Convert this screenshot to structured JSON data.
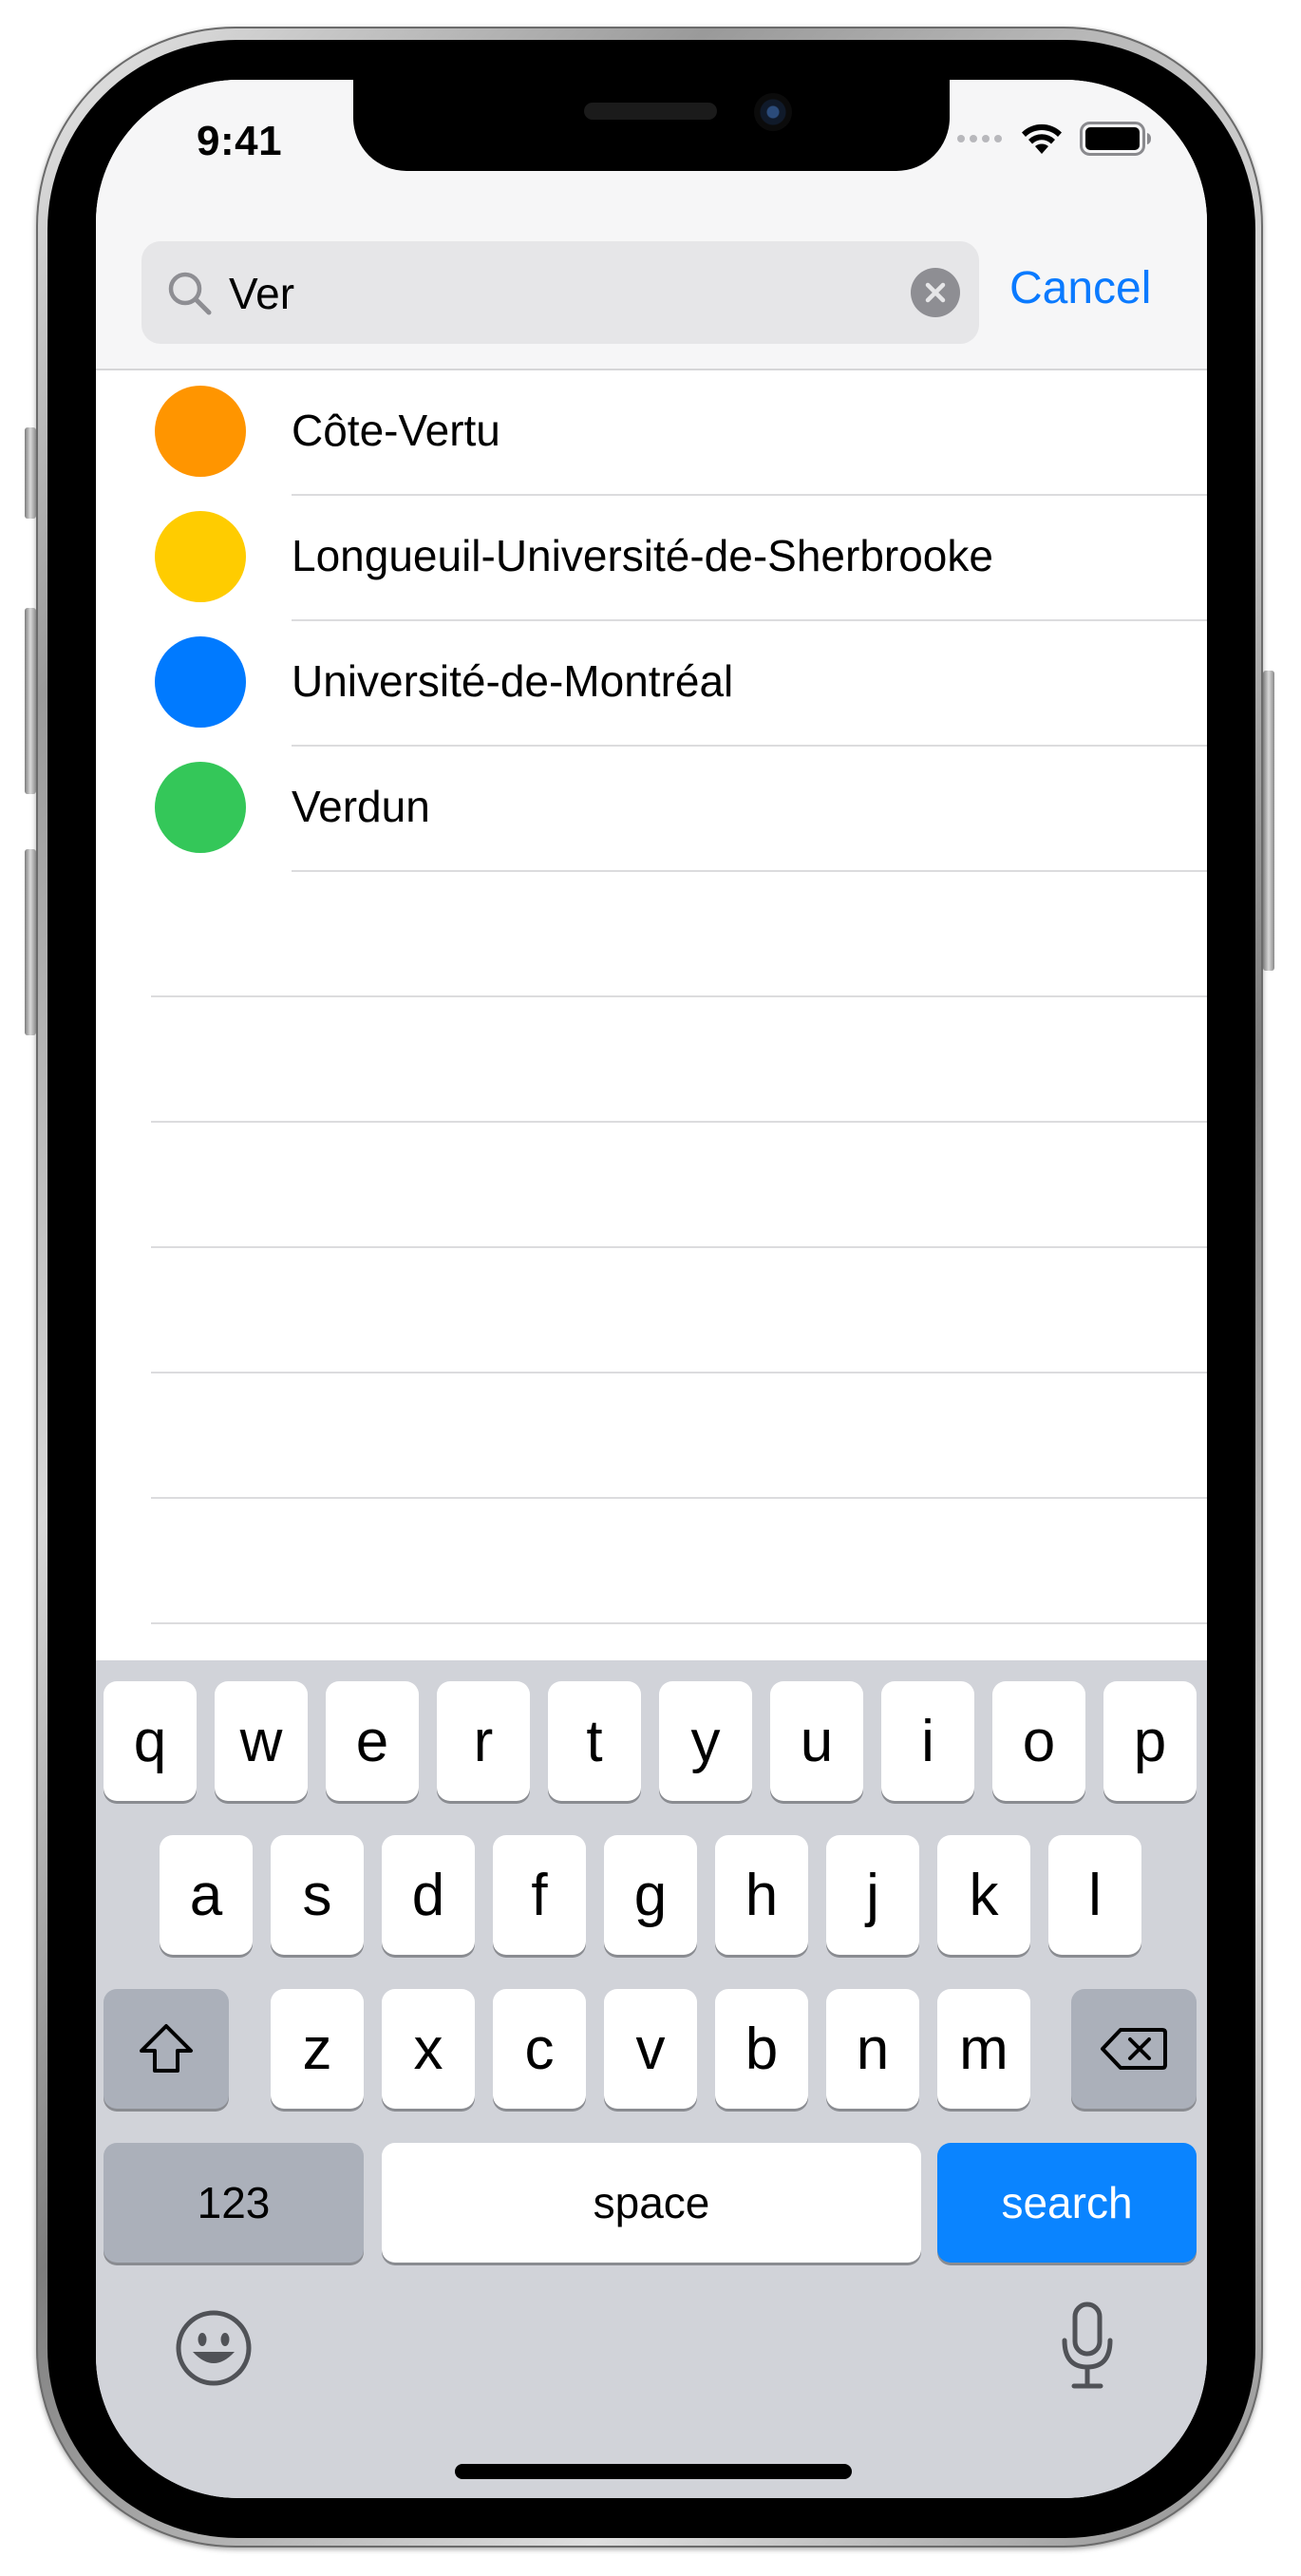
{
  "status_bar": {
    "time": "9:41"
  },
  "search": {
    "query": "Ver",
    "cancel_label": "Cancel"
  },
  "results": [
    {
      "label": "Côte-Vertu",
      "color": "#ff9500"
    },
    {
      "label": "Longueuil-Université-de-Sherbrooke",
      "color": "#ffcc00"
    },
    {
      "label": "Université-de-Montréal",
      "color": "#007aff"
    },
    {
      "label": "Verdun",
      "color": "#34c759"
    }
  ],
  "keyboard": {
    "row1": [
      "q",
      "w",
      "e",
      "r",
      "t",
      "y",
      "u",
      "i",
      "o",
      "p"
    ],
    "row2": [
      "a",
      "s",
      "d",
      "f",
      "g",
      "h",
      "j",
      "k",
      "l"
    ],
    "row3": [
      "z",
      "x",
      "c",
      "v",
      "b",
      "n",
      "m"
    ],
    "numbers_label": "123",
    "space_label": "space",
    "search_label": "search",
    "icons": {
      "shift": "shift-icon",
      "delete": "delete-icon",
      "emoji": "emoji-icon",
      "mic": "microphone-icon"
    }
  }
}
